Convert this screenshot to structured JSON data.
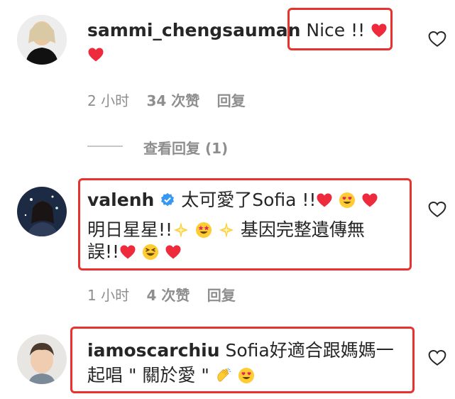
{
  "comments": [
    {
      "username": "sammi_chengsauman",
      "text_line1": "Nice !!",
      "time": "2 小时",
      "likes": "34 次赞",
      "reply": "回复",
      "view_replies": "查看回复 (1)"
    },
    {
      "username": "valenh",
      "verified": true,
      "text_line1": "太可愛了Sofia !!",
      "text_line2_a": "明日星星!!",
      "text_line2_b": "基因完整遺傳無",
      "text_line3": "誤!!",
      "time": "1 小时",
      "likes": "4 次赞",
      "reply": "回复"
    },
    {
      "username": "iamoscarchiu",
      "text_line1": "Sofia好適合跟媽媽一",
      "text_line2": "起唱 \" 關於愛 \""
    }
  ],
  "colors": {
    "highlight_border": "#e8322e",
    "heart": "#ed2b3c",
    "verified": "#3897f0",
    "meta_text": "#8e8e8e",
    "body_text": "#262626"
  },
  "icons": [
    "heart-emoji",
    "heart-eyes-emoji",
    "sparkle-star-emoji",
    "star-struck-emoji",
    "grinning-squint-emoji",
    "clapping-hands-emoji",
    "verified-badge-icon",
    "like-heart-icon"
  ]
}
